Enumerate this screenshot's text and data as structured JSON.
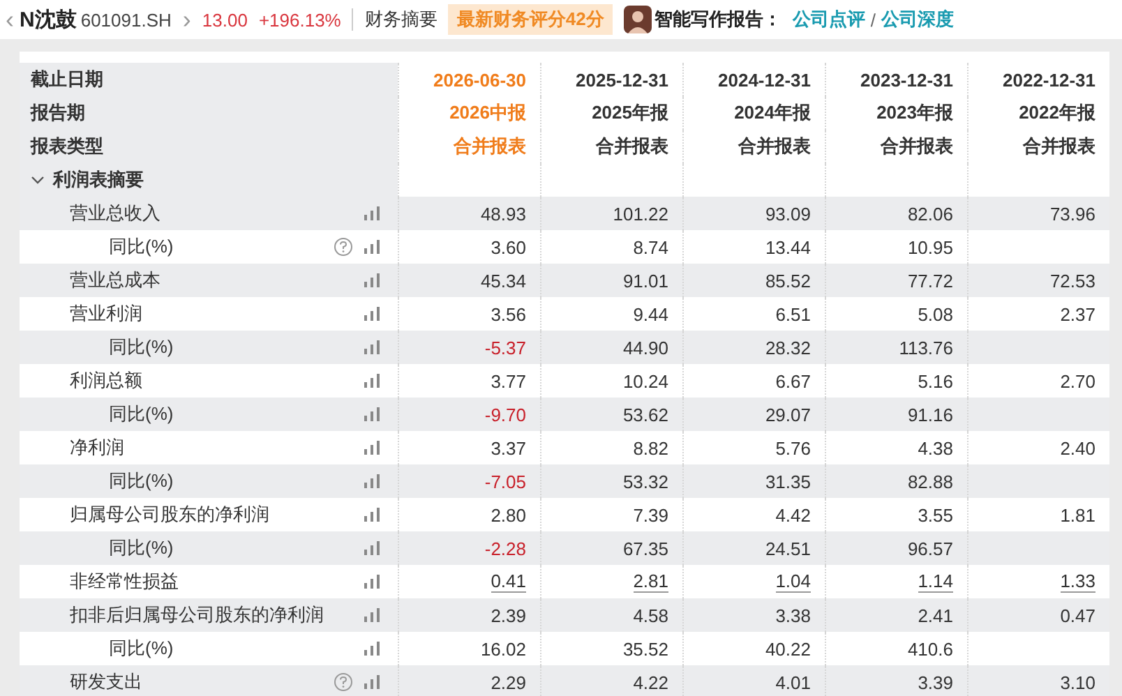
{
  "header": {
    "back": "‹",
    "name": "N沈鼓",
    "code": "601091.SH",
    "forward": "›",
    "price": "13.00",
    "change": "+196.13%",
    "tab": "财务摘要",
    "badge": "最新财务评分42分",
    "report_label": "智能写作报告：",
    "links": [
      "公司点评",
      "公司深度"
    ],
    "link_sep": "/"
  },
  "table": {
    "head_labels": [
      "截止日期",
      "报告期",
      "报表类型"
    ],
    "columns": [
      {
        "date": "2026-06-30",
        "period": "2026中报",
        "type": "合并报表",
        "selected": true
      },
      {
        "date": "2025-12-31",
        "period": "2025年报",
        "type": "合并报表",
        "selected": false
      },
      {
        "date": "2024-12-31",
        "period": "2024年报",
        "type": "合并报表",
        "selected": false
      },
      {
        "date": "2023-12-31",
        "period": "2023年报",
        "type": "合并报表",
        "selected": false
      },
      {
        "date": "2022-12-31",
        "period": "2022年报",
        "type": "合并报表",
        "selected": false
      }
    ],
    "section": {
      "title": "利润表摘要",
      "rows": [
        {
          "label": "营业总收入",
          "help": false,
          "underlined": false,
          "first_down": false,
          "values": [
            "48.93",
            "101.22",
            "93.09",
            "82.06",
            "73.96"
          ],
          "children": [
            {
              "label": "同比(%)",
              "help": true,
              "underlined": false,
              "first_down": false,
              "values": [
                "3.60",
                "8.74",
                "13.44",
                "10.95"
              ]
            }
          ]
        },
        {
          "label": "营业总成本",
          "help": false,
          "underlined": false,
          "first_down": false,
          "values": [
            "45.34",
            "91.01",
            "85.52",
            "77.72",
            "72.53"
          ]
        },
        {
          "label": "营业利润",
          "help": false,
          "underlined": false,
          "first_down": false,
          "values": [
            "3.56",
            "9.44",
            "6.51",
            "5.08",
            "2.37"
          ],
          "children": [
            {
              "label": "同比(%)",
              "help": false,
              "underlined": false,
              "first_down": true,
              "values": [
                "-5.37",
                "44.90",
                "28.32",
                "113.76"
              ]
            }
          ]
        },
        {
          "label": "利润总额",
          "help": false,
          "underlined": false,
          "first_down": false,
          "values": [
            "3.77",
            "10.24",
            "6.67",
            "5.16",
            "2.70"
          ],
          "children": [
            {
              "label": "同比(%)",
              "help": false,
              "underlined": false,
              "first_down": true,
              "values": [
                "-9.70",
                "53.62",
                "29.07",
                "91.16"
              ]
            }
          ]
        },
        {
          "label": "净利润",
          "help": false,
          "underlined": false,
          "first_down": false,
          "values": [
            "3.37",
            "8.82",
            "5.76",
            "4.38",
            "2.40"
          ],
          "children": [
            {
              "label": "同比(%)",
              "help": false,
              "underlined": false,
              "first_down": true,
              "values": [
                "-7.05",
                "53.32",
                "31.35",
                "82.88"
              ]
            }
          ]
        },
        {
          "label": "归属母公司股东的净利润",
          "help": false,
          "underlined": false,
          "first_down": false,
          "values": [
            "2.80",
            "7.39",
            "4.42",
            "3.55",
            "1.81"
          ],
          "children": [
            {
              "label": "同比(%)",
              "help": false,
              "underlined": false,
              "first_down": true,
              "values": [
                "-2.28",
                "67.35",
                "24.51",
                "96.57"
              ]
            }
          ]
        },
        {
          "label": "非经常性损益",
          "help": false,
          "underlined": true,
          "first_down": false,
          "values": [
            "0.41",
            "2.81",
            "1.04",
            "1.14",
            "1.33"
          ]
        },
        {
          "label": "扣非后归属母公司股东的净利润",
          "help": false,
          "underlined": false,
          "first_down": false,
          "values": [
            "2.39",
            "4.58",
            "3.38",
            "2.41",
            "0.47"
          ],
          "children": [
            {
              "label": "同比(%)",
              "help": false,
              "underlined": false,
              "first_down": false,
              "values": [
                "16.02",
                "35.52",
                "40.22",
                "410.6"
              ]
            }
          ]
        },
        {
          "label": "研发支出",
          "help": true,
          "underlined": false,
          "first_down": false,
          "values": [
            "2.29",
            "4.22",
            "4.01",
            "3.39",
            "3.10"
          ]
        }
      ]
    }
  }
}
